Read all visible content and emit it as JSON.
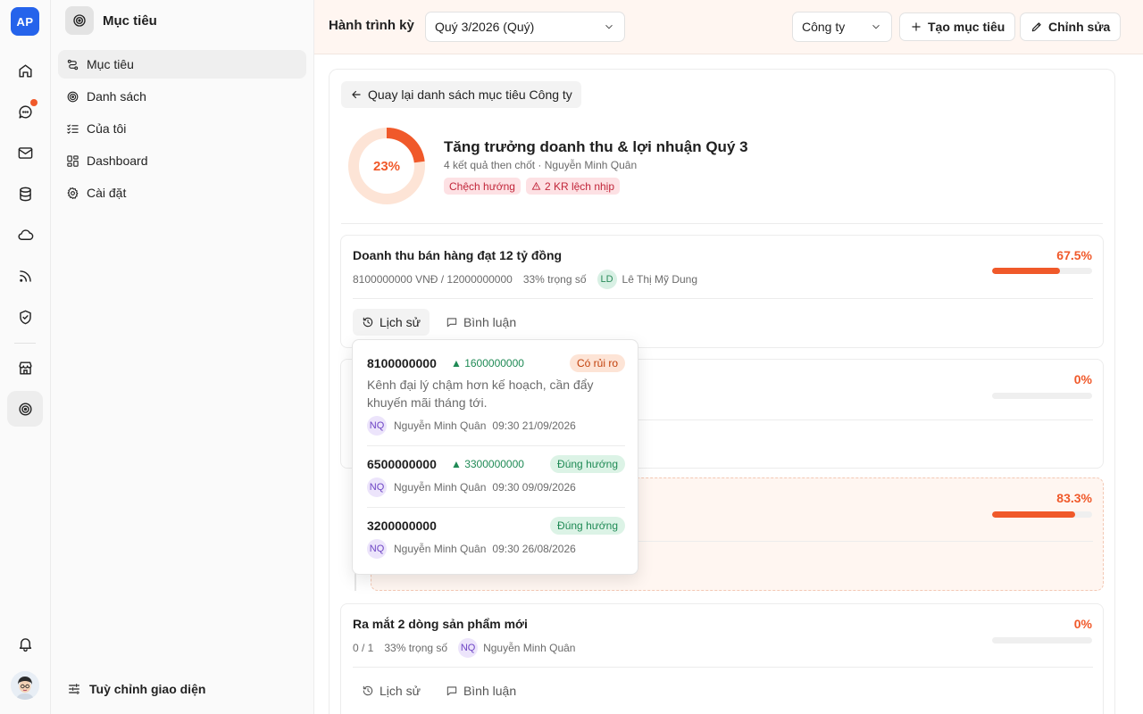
{
  "rail": {
    "logo": "AP",
    "items": [
      "home-icon",
      "chat-icon",
      "mail-icon",
      "database-icon",
      "cloud-icon",
      "rss-icon",
      "shield-icon",
      "store-icon",
      "target-icon"
    ],
    "bottom": [
      "bell-icon",
      "user-avatar"
    ]
  },
  "sidebar": {
    "title": "Mục tiêu",
    "items": [
      {
        "label": "Mục tiêu",
        "icon": "goal-icon",
        "active": true
      },
      {
        "label": "Danh sách",
        "icon": "target-icon"
      },
      {
        "label": "Của tôi",
        "icon": "list-check-icon"
      },
      {
        "label": "Dashboard",
        "icon": "dashboard-icon"
      },
      {
        "label": "Cài đặt",
        "icon": "gear-icon"
      }
    ],
    "footer": "Tuỳ chỉnh giao diện"
  },
  "topbar": {
    "period_label": "Hành trình kỳ",
    "period_value": "Quý 3/2026 (Quý)",
    "scope_value": "Công ty",
    "create_label": "Tạo mục tiêu",
    "edit_label": "Chỉnh sửa"
  },
  "objective": {
    "back_label": "Quay lại danh sách mục tiêu Công ty",
    "progress": 23,
    "progress_label": "23%",
    "title": "Tăng trưởng doanh thu & lợi nhuận Quý 3",
    "subtitle": "4 kết quả then chốt · Nguyễn Minh Quân",
    "status_badge": "Chệch hướng",
    "alert_badge": "2 KR lệch nhịp"
  },
  "key_results": [
    {
      "title": "Doanh thu bán hàng đạt 12 tỷ đồng",
      "value": "8100000000 VNĐ / 12000000000",
      "weight": "33% trọng số",
      "owner_initials": "LD",
      "owner": "Lê Thị Mỹ Dung",
      "progress": 67.5,
      "progress_label": "67.5%"
    },
    {
      "progress": 0,
      "progress_label": "0%"
    },
    {
      "progress": 83.3,
      "progress_label": "83.3%"
    },
    {
      "title": "Ra mắt 2 dòng sản phẩm mới",
      "value": "0 / 1",
      "weight": "33% trọng số",
      "owner_initials": "NQ",
      "owner": "Nguyễn Minh Quân",
      "progress": 0,
      "progress_label": "0%"
    }
  ],
  "actions": {
    "history": "Lịch sử",
    "comment": "Bình luận"
  },
  "history": [
    {
      "value": "8100000000",
      "delta": "▲ 1600000000",
      "status": "Có rủi ro",
      "note": "Kênh đại lý chậm hơn kế hoạch, cần đẩy khuyến mãi tháng tới.",
      "author_initials": "NQ",
      "author": "Nguyễn Minh Quân",
      "time": "09:30 21/09/2026"
    },
    {
      "value": "6500000000",
      "delta": "▲ 3300000000",
      "status": "Đúng hướng",
      "author_initials": "NQ",
      "author": "Nguyễn Minh Quân",
      "time": "09:30 09/09/2026"
    },
    {
      "value": "3200000000",
      "status": "Đúng hướng",
      "author_initials": "NQ",
      "author": "Nguyễn Minh Quân",
      "time": "09:30 26/08/2026"
    }
  ],
  "colors": {
    "accent": "#f0592a",
    "brand": "#2563eb",
    "ok": "#1f8a55",
    "danger": "#c1263a"
  }
}
